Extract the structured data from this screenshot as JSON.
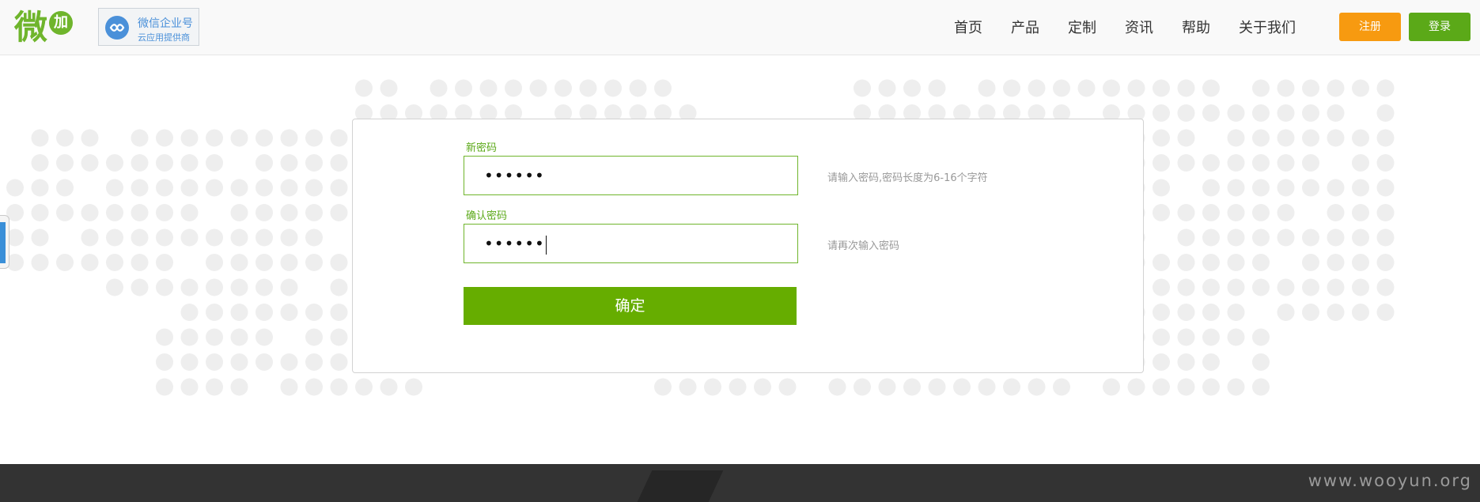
{
  "header": {
    "logo": {
      "main": "微",
      "sub": "加"
    },
    "badge": {
      "title": "微信企业号",
      "subtitle": "云应用提供商"
    },
    "nav": [
      "首页",
      "产品",
      "定制",
      "资讯",
      "帮助",
      "关于我们"
    ],
    "register_label": "注册",
    "login_label": "登录"
  },
  "form": {
    "new_password": {
      "label": "新密码",
      "value": "••••••",
      "hint": "请输入密码,密码长度为6-16个字符"
    },
    "confirm_password": {
      "label": "确认密码",
      "value": "••••••",
      "hint": "请再次输入密码"
    },
    "submit_label": "确定"
  },
  "footer": {
    "watermark": "www.wooyun.org"
  },
  "colors": {
    "accent": "#66ad00",
    "register": "#f79a10",
    "footer": "#333333"
  },
  "icons": [
    "wechat-enterprise-icon"
  ]
}
